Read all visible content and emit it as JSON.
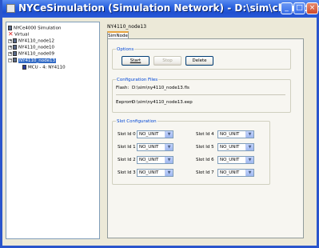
{
  "window": {
    "title": "NYCeSimulation (Simulation Network) - D:\\sim\\clone.xml",
    "controls": {
      "minimize": "_",
      "maximize": "□",
      "close": "×"
    }
  },
  "tree": {
    "items": [
      {
        "label": "NYCe4000 Simulation",
        "icon": "computer-icon",
        "expander": ""
      },
      {
        "label": "Virtual",
        "icon": "x-icon",
        "expander": ""
      },
      {
        "label": "NY4110_node12",
        "icon": "device-icon",
        "expander": "+"
      },
      {
        "label": "NY4110_node10",
        "icon": "device-icon",
        "expander": "+"
      },
      {
        "label": "NY4110_node09",
        "icon": "device-icon",
        "expander": "+"
      },
      {
        "label": "NY4110_node13",
        "icon": "device-icon",
        "expander": "−",
        "selected": true
      },
      {
        "label": "MCU - 4: NY4110",
        "icon": "chip-icon",
        "expander": ""
      }
    ]
  },
  "main": {
    "node_name": "NY4110_node13",
    "tab_label": "SimNode",
    "options": {
      "group_label": "Options",
      "start_label": "Start",
      "stop_label": "Stop",
      "delete_label": "Delete"
    },
    "config_files": {
      "group_label": "Configuration Files",
      "flash_label": "Flash:",
      "flash_value": "D:\\sim\\ny4110_node13.fls",
      "eeprom_label": "Eeprom:",
      "eeprom_value": "D:\\sim\\ny4110_node13.eep"
    },
    "slot_config": {
      "group_label": "Slot Configuration",
      "slots": [
        {
          "label": "Slot Id 0",
          "value": "NO_UNIT"
        },
        {
          "label": "Slot Id 4",
          "value": "NO_UNIT"
        },
        {
          "label": "Slot Id 1",
          "value": "NO_UNIT"
        },
        {
          "label": "Slot Id 5",
          "value": "NO_UNIT"
        },
        {
          "label": "Slot Id 2",
          "value": "NO_UNIT"
        },
        {
          "label": "Slot Id 6",
          "value": "NO_UNIT"
        },
        {
          "label": "Slot Id 3",
          "value": "NO_UNIT"
        },
        {
          "label": "Slot Id 7",
          "value": "NO_UNIT"
        }
      ]
    }
  },
  "colors": {
    "title_bar": "#2b63e0",
    "selection": "#316ac5",
    "group_label": "#0046d5"
  }
}
